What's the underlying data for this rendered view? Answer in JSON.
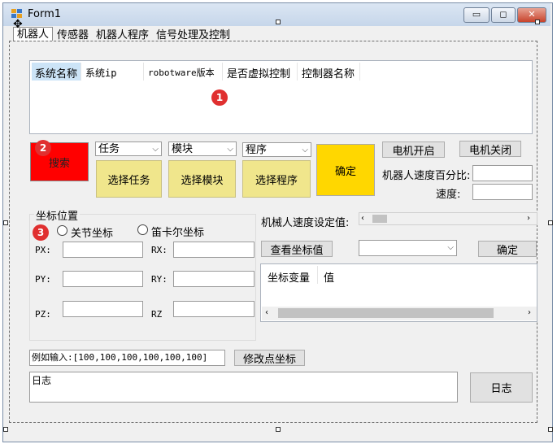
{
  "window": {
    "title": "Form1",
    "min_glyph": "▭",
    "max_glyph": "◻",
    "close_glyph": "✕"
  },
  "tabs": [
    "机器人",
    "传感器",
    "机器人程序",
    "信号处理及控制"
  ],
  "controller_table": {
    "columns": [
      "系统名称",
      "系统ip",
      "robotware版本",
      "是否虚拟控制",
      "控制器名称"
    ]
  },
  "badges": [
    "1",
    "2",
    "3"
  ],
  "search_button": "搜索",
  "combos": {
    "task": "任务",
    "module": "模块",
    "program": "程序",
    "arrow": "⌵"
  },
  "buttons": {
    "select_task": "选择任务",
    "select_module": "选择模块",
    "select_program": "选择程序",
    "confirm_main": "确定",
    "motor_on": "电机开启",
    "motor_off": "电机关闭",
    "view_coords": "查看坐标值",
    "confirm_speed": "确定",
    "modify_point": "修改点坐标",
    "log": "日志"
  },
  "labels": {
    "speed_percent": "机器人速度百分比:",
    "speed": "速度:",
    "robot_speed_setting": "机械人速度设定值:",
    "coord_group": "坐标位置",
    "joint_coords": "关节坐标",
    "cartesian_coords": "笛卡尔坐标",
    "px": "PX:",
    "py": "PY:",
    "pz": "PZ:",
    "rx": "RX:",
    "ry": "RY:",
    "rz": "RZ"
  },
  "coord_table": {
    "columns": [
      "坐标变量",
      "值"
    ]
  },
  "example_input": "例如输入:[100,100,100,100,100,100]",
  "log_box": "日志",
  "colors": {
    "search_red": "#ff0000",
    "select_yellow": "#f0e68c",
    "confirm_gold": "#ffd700",
    "badge_red": "#e03030"
  }
}
